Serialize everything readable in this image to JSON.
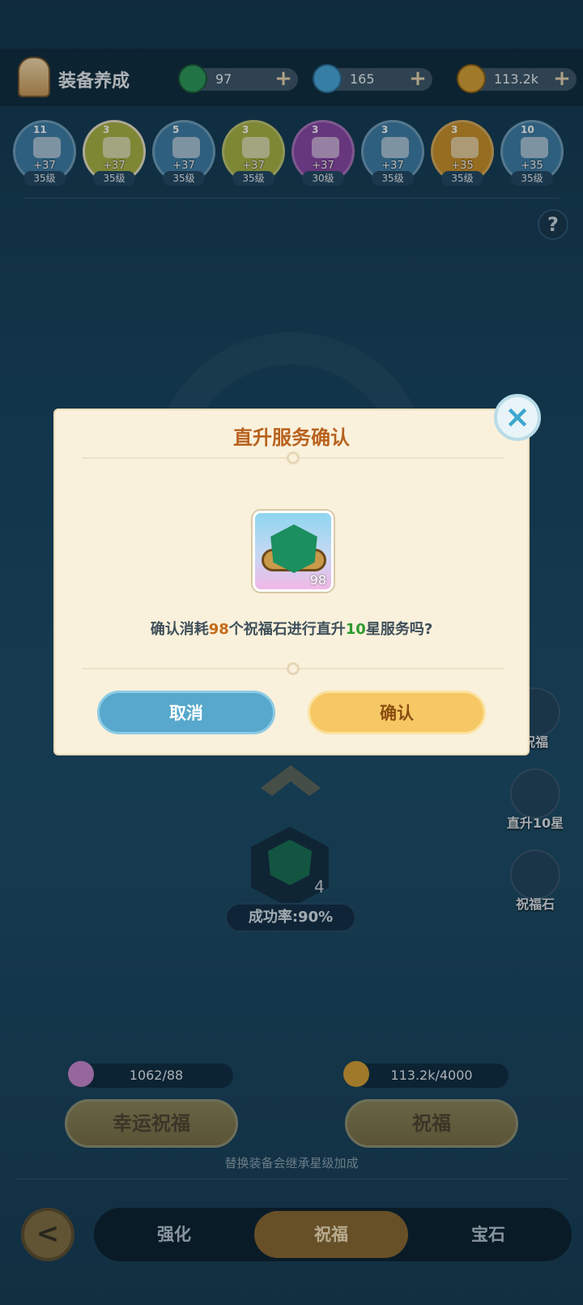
{
  "header": {
    "title": "装备养成",
    "resources": [
      {
        "icon": "green-gem-icon",
        "value": "97",
        "color": "#2e9a5e"
      },
      {
        "icon": "blue-diamond-icon",
        "value": "165",
        "color": "#4aa9dc"
      },
      {
        "icon": "gold-coin-icon",
        "value": "113.2k",
        "color": "#d6a23a"
      }
    ]
  },
  "equipment": [
    {
      "stars": "11",
      "plus": "+37",
      "level": "35级",
      "color": "#3f7fa8"
    },
    {
      "stars": "3",
      "plus": "+37",
      "level": "35级",
      "color": "#a8b446"
    },
    {
      "stars": "5",
      "plus": "+37",
      "level": "35级",
      "color": "#3f7fa8"
    },
    {
      "stars": "3",
      "plus": "+37",
      "level": "35级",
      "color": "#a8b446"
    },
    {
      "stars": "3",
      "plus": "+37",
      "level": "30级",
      "color": "#8a4aa8"
    },
    {
      "stars": "3",
      "plus": "+37",
      "level": "35级",
      "color": "#3f7fa8"
    },
    {
      "stars": "3",
      "plus": "+35",
      "level": "35级",
      "color": "#c8922c"
    },
    {
      "stars": "10",
      "plus": "+35",
      "level": "35级",
      "color": "#3f7fa8"
    }
  ],
  "help_label": "?",
  "side_actions": [
    {
      "label": "祝福"
    },
    {
      "label": "直升10星"
    },
    {
      "label": "祝福石"
    }
  ],
  "center": {
    "gem_count": "4",
    "success_rate": "成功率:90%"
  },
  "costs": {
    "lucky_cost": "1062/88",
    "bless_cost": "113.2k/4000"
  },
  "buttons": {
    "lucky_bless": "幸运祝福",
    "bless": "祝福"
  },
  "hint": "替换装备会继承星级加成",
  "nav": {
    "back": "<",
    "tabs": [
      "强化",
      "祝福",
      "宝石"
    ],
    "active_index": 1
  },
  "dialog": {
    "title": "直升服务确认",
    "item_count": "98",
    "text_prefix": "确认消耗",
    "text_amount": "98",
    "text_middle": "个祝福石进行直升",
    "text_stars": "10",
    "text_suffix": "星服务吗?",
    "cancel": "取消",
    "confirm": "确认",
    "close": "×"
  }
}
